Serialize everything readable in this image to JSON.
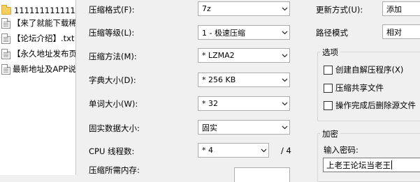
{
  "files": [
    {
      "name": "11111111111111",
      "icon": "folder-icon"
    },
    {
      "name": "【来了就能下载稀",
      "icon": "document-icon"
    },
    {
      "name": "【论坛介绍】.txt",
      "icon": "document-icon"
    },
    {
      "name": "【永久地址发布页",
      "icon": "document-icon"
    },
    {
      "name": "最新地址及APP说",
      "icon": "document-icon"
    }
  ],
  "form": {
    "format_label": "压缩格式(F):",
    "format_value": "7z",
    "level_label": "压缩等级(L):",
    "level_value": "1 - 极速压缩",
    "method_label": "压缩方法(M):",
    "method_value": "* LZMA2",
    "dict_label": "字典大小(D):",
    "dict_value": "* 256 KB",
    "word_label": "单词大小(W):",
    "word_value": "* 32",
    "solid_label": "固实数据大小:",
    "solid_value": "固实",
    "cpu_label": "CPU 线程数:",
    "cpu_value": "* 4",
    "cpu_total": "/ 4",
    "mem_label": "压缩所需内存:"
  },
  "right": {
    "update_label": "更新方式(U):",
    "update_value": "添加",
    "path_label": "路径模式",
    "path_value": "相对",
    "options_title": "选项",
    "opt_sfx": "创建自解压程序(X)",
    "opt_shared": "压缩共享文件",
    "opt_delete": "操作完成后删除源文件",
    "encrypt_title": "加密",
    "password_label": "输入密码:",
    "password_value": "上老王论坛当老王"
  }
}
